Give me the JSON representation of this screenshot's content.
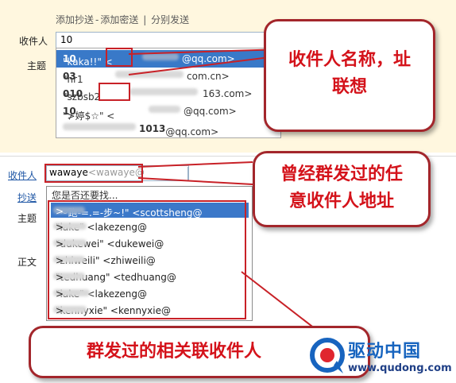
{
  "top": {
    "links": [
      "添加抄送",
      "添加密送",
      "分别发送"
    ],
    "link_sep": "-",
    "link_sep2": "|",
    "recipient_label": "收件人",
    "subject_label": "主题",
    "recipient_value": "10",
    "suggestions": [
      {
        "prefix": "\"kaka!!\" <",
        "hit": "10",
        "suffix": "@qq.com>"
      },
      {
        "prefix": "\"hr1",
        "hit": "03",
        "suffix": "com.cn>"
      },
      {
        "prefix": "\"szbsb2",
        "hit": "010",
        "suffix": "163.com>"
      },
      {
        "prefix": "\"≯婷$☆\" <",
        "hit": "10",
        "suffix": "@qq.com>"
      },
      {
        "prefix": "",
        "hit": "1013",
        "suffix": "@qq.com>"
      }
    ]
  },
  "callouts": {
    "c1": [
      "收件人名称，址",
      "联想"
    ],
    "c2": [
      "曾经群发过的任",
      "意收件人地址"
    ],
    "c3": "群发过的相关联收件人"
  },
  "bottom": {
    "recipient_label": "收件人",
    "cc_label": "抄送",
    "subject_label": "主题",
    "body_label": "正文",
    "recipient_value": "wawaye",
    "recipient_hint": "<wawaye@",
    "header": "您是否还要找...",
    "items": [
      "\"~跑-=.=-步~!\" <scottsheng@",
      "\"lake\" <lakezeng@",
      "\"dukewei\" <dukewei@",
      "\"zhiweili\" <zhiweili@",
      "\"tedhuang\" <tedhuang@",
      "\"lake\" <lakezeng@",
      "\"kennyxie\" <kennyxie@"
    ],
    "item_suffix": ">"
  },
  "footer": {
    "logo": "驱动中国",
    "url": "www.qudong.com"
  },
  "colors": {
    "accent_red": "#c82127",
    "selection_blue": "#3979c8",
    "link_blue": "#1d55a4"
  }
}
